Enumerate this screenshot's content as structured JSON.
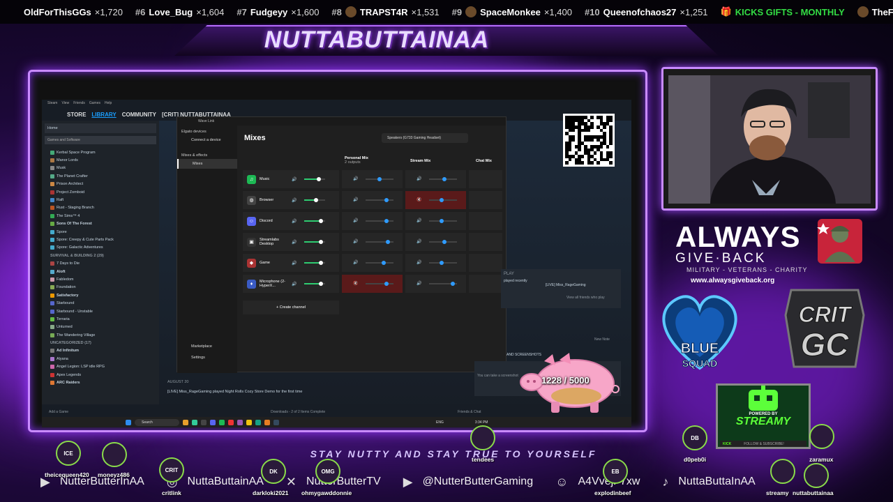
{
  "ticker": {
    "items": [
      {
        "rank": "",
        "name": "OldForThisGGs",
        "count": "×1,720"
      },
      {
        "rank": "#6",
        "name": "Love_Bug",
        "count": "×1,604"
      },
      {
        "rank": "#7",
        "name": "Fudgeyy",
        "count": "×1,600"
      },
      {
        "rank": "#8",
        "name": "TRAPST4R",
        "count": "×1,531"
      },
      {
        "rank": "#9",
        "name": "SpaceMonkee",
        "count": "×1,400"
      },
      {
        "rank": "#10",
        "name": "Queenofchaos27",
        "count": "×1,251"
      }
    ],
    "gift_label": "KICKS GIFTS - MONTHLY",
    "gift_user": "TheFish"
  },
  "brand": "NUTTABUTTAINAA",
  "steam": {
    "top_menu": [
      "Steam",
      "View",
      "Friends",
      "Games",
      "Help"
    ],
    "nav": {
      "store": "STORE",
      "library": "LIBRARY",
      "community": "COMMUNITY",
      "user": "[CRIT] NUTTABUTTAINAA"
    },
    "home": "Home",
    "filter": "Games and Software",
    "games": [
      {
        "name": "Kerbal Space Program",
        "c": "#4a7"
      },
      {
        "name": "Manor Lords",
        "c": "#a74"
      },
      {
        "name": "Musk",
        "c": "#888"
      },
      {
        "name": "The Planet Crafter",
        "c": "#5a8"
      },
      {
        "name": "Prison Architect",
        "c": "#c84"
      },
      {
        "name": "Project Zomboid",
        "c": "#a33"
      },
      {
        "name": "Raft",
        "c": "#48c"
      },
      {
        "name": "Rust - Staging Branch",
        "c": "#b52"
      },
      {
        "name": "The Sims™ 4",
        "c": "#3a5"
      },
      {
        "name": "Sons Of The Forest",
        "c": "#6a4",
        "bold": true
      },
      {
        "name": "Spore",
        "c": "#4ac"
      },
      {
        "name": "Spore: Creepy & Cute Parts Pack",
        "c": "#4ac"
      },
      {
        "name": "Spore: Galactic Adventures",
        "c": "#4ac"
      },
      {
        "name": "SURVIVAL & BUILDING 2 (29)",
        "head": true
      },
      {
        "name": "7 Days to Die",
        "c": "#a44"
      },
      {
        "name": "Aloft",
        "c": "#5ac",
        "bold": true
      },
      {
        "name": "Fabledom",
        "c": "#c9a"
      },
      {
        "name": "Foundation",
        "c": "#8a5"
      },
      {
        "name": "Satisfactory",
        "c": "#e90",
        "bold": true
      },
      {
        "name": "Starbound",
        "c": "#56c"
      },
      {
        "name": "Starbound - Unstable",
        "c": "#56c"
      },
      {
        "name": "Terraria",
        "c": "#6b4"
      },
      {
        "name": "Unturned",
        "c": "#8a8"
      },
      {
        "name": "The Wandering Village",
        "c": "#7a5"
      },
      {
        "name": "UNCATEGORIZED (17)",
        "head": true
      },
      {
        "name": "Ad Infinitum",
        "c": "#777",
        "bold": true
      },
      {
        "name": "Alyana",
        "c": "#a7c"
      },
      {
        "name": "Angel Legion: LSP idle RPG",
        "c": "#c6a"
      },
      {
        "name": "Apex Legends",
        "c": "#c33"
      },
      {
        "name": "ARC Raiders",
        "c": "#d73",
        "bold": true
      }
    ],
    "add_game": "Add a Game",
    "downloads": "Downloads - 2 of 2 Items Complete",
    "friends_chat": "Friends & Chat",
    "activity_date": "AUGUST 20",
    "activity_text": "[LIVE] Miss_RageGaming played  Night Rolls Cozy Store Demo for the first time",
    "play_label": "PLAY",
    "friends_played": "played recently",
    "friend_name": "[LIVE] Miss_RageGaming",
    "friends_link": "View all friends who play",
    "new_note": "New Note",
    "screenshots": "AND SCREENSHOTS",
    "screen_hint": "You can take a screenshot"
  },
  "wave": {
    "title": "Wave Link",
    "devices_head": "Elgato devices",
    "connect": "Connect a device",
    "mixes_head": "Mixes & effects",
    "mixes_item": "Mixes",
    "marketplace": "Marketplace",
    "settings": "Settings",
    "heading": "Mixes",
    "output": "Speakers (G733 Gaming Headset)",
    "cols": {
      "personal": "Personal Mix",
      "personal_sub": "2 outputs",
      "stream": "Stream Mix",
      "chat": "Chat Mix"
    },
    "channels": [
      {
        "name": "Music",
        "icon": "spotify-icon",
        "color": "#1db954",
        "glyph": "♫",
        "src": 0.7,
        "p": 0.5,
        "s": 0.55,
        "p_muted": false,
        "s_muted": false
      },
      {
        "name": "Browser",
        "icon": "browser-icon",
        "color": "#444",
        "glyph": "◍",
        "src": 0.55,
        "p": 0.75,
        "s": 0.45,
        "p_muted": false,
        "s_muted": true
      },
      {
        "name": "Discord",
        "icon": "discord-icon",
        "color": "#5865f2",
        "glyph": "☺",
        "src": 0.8,
        "p": 0.75,
        "s": 0.45,
        "p_muted": false,
        "s_muted": false
      },
      {
        "name": "Streamlabs Desktop",
        "icon": "streamlabs-icon",
        "color": "#333",
        "glyph": "▣",
        "src": 0.8,
        "p": 0.8,
        "s": 0.55,
        "p_muted": false,
        "s_muted": false
      },
      {
        "name": "Game",
        "icon": "game-icon",
        "color": "#a33",
        "glyph": "◆",
        "src": 0.8,
        "p": 0.65,
        "s": 0.45,
        "p_muted": false,
        "s_muted": false
      },
      {
        "name": "Microphone (2- HyperX...",
        "icon": "microphone-icon",
        "color": "#3a5bc4",
        "glyph": "♦",
        "src": 0.8,
        "p": 0.75,
        "s": 0.85,
        "p_muted": true,
        "s_muted": false
      }
    ],
    "create": "+ Create channel"
  },
  "taskbar": {
    "search": "Search",
    "lang": "ENG",
    "time": "3:34 PM"
  },
  "pig": {
    "label": "1228 / 5000"
  },
  "sponsor": {
    "title": "ALWAYS",
    "sub": "GIVE·BACK",
    "tag": "MILITARY - VETERANS - CHARITY",
    "url": "www.alwaysgiveback.org"
  },
  "blue_squad": "BLUE SQUAD",
  "crit_gc": {
    "top": "CRIT",
    "bottom": "GC"
  },
  "streamy": {
    "pre": "POWERED BY",
    "name": "STREAMY",
    "foot_left": "KICK",
    "foot_right": "FOLLOW & SUBSCRIBE!"
  },
  "slogan": "STAY NUTTY AND STAY TRUE TO YOURSELF",
  "socials": [
    {
      "icon": "youtube-icon",
      "text": "NutterButterInAA"
    },
    {
      "icon": "instagram-icon",
      "text": "NuttaButtainAA"
    },
    {
      "icon": "x-icon",
      "text": "NutterButterTV"
    },
    {
      "icon": "youtube-icon",
      "text": "@NutterButterGaming"
    },
    {
      "icon": "discord-icon",
      "text": "A4VvejF7xw"
    },
    {
      "icon": "tiktok-icon",
      "text": "NuttaButtaInAA"
    }
  ],
  "viewers": [
    {
      "name": "theicequeen420",
      "badge": "ICE"
    },
    {
      "name": "moneyz486",
      "badge": ""
    },
    {
      "name": "critlink",
      "badge": "CRIT"
    },
    {
      "name": "darkloki2021",
      "badge": "DK"
    },
    {
      "name": "ohmygawddonnie",
      "badge": "OMG"
    },
    {
      "name": "tendees",
      "badge": ""
    },
    {
      "name": "explodinbeef",
      "badge": "EB"
    },
    {
      "name": "d0peb0i",
      "badge": "DB"
    },
    {
      "name": "zaramux",
      "badge": ""
    },
    {
      "name": "streamy",
      "badge": ""
    },
    {
      "name": "nuttabuttainaa",
      "badge": ""
    }
  ]
}
